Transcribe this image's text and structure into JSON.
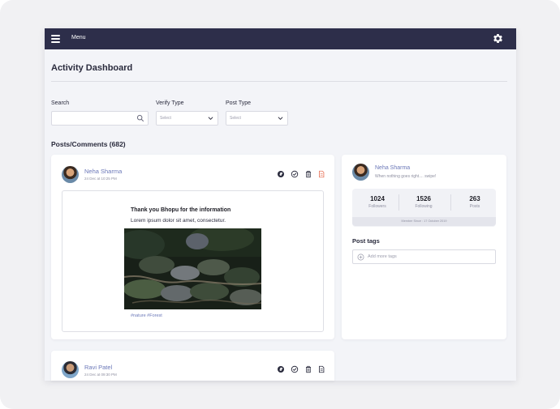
{
  "topbar": {
    "menu_label": "Menu",
    "accent_color": "#2d2e4a"
  },
  "page": {
    "title": "Activity Dashboard"
  },
  "filters": {
    "search_label": "Search",
    "search_value": "",
    "verify_label": "Verify Type",
    "verify_value": "Select",
    "post_type_label": "Post Type",
    "post_type_value": "Select"
  },
  "posts_section": {
    "title": "Posts/Comments (682)"
  },
  "posts": [
    {
      "author": "Neha Sharma",
      "date": "24 Dec at 10:25 PM",
      "title": "Thank you Bhopu for the information",
      "body": "Lorem ipsum dolor sit amet, consectetur.",
      "tags": "#nature #Forest",
      "actions": [
        "globe-icon",
        "check-circle-icon",
        "trash-icon",
        "flag-icon"
      ]
    },
    {
      "author": "Ravi Patel",
      "date": "24 Dec at 09:30 PM",
      "actions": [
        "globe-icon",
        "check-circle-icon",
        "trash-icon",
        "flag-icon"
      ]
    }
  ],
  "profile": {
    "name": "Neha Sharma",
    "status": "When nothing goes right.... swipe!",
    "stats": [
      {
        "value": "1024",
        "label": "Followers"
      },
      {
        "value": "1526",
        "label": "Following"
      },
      {
        "value": "263",
        "label": "Posts"
      }
    ],
    "member_since": "Member Since : 17 October 2019",
    "tags_title": "Post tags",
    "add_tags_placeholder": "Add more tags"
  }
}
